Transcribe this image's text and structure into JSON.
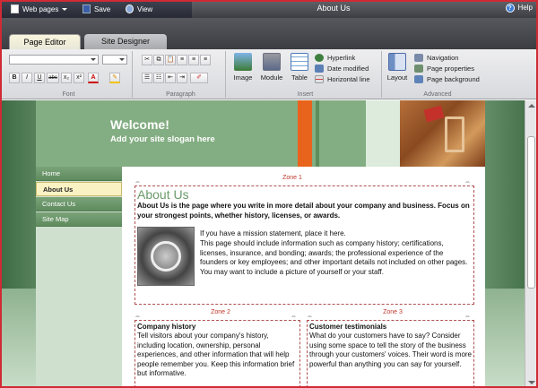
{
  "app": {
    "title": "About Us",
    "help_label": "Help"
  },
  "topbar": {
    "web_pages": "Web pages",
    "save": "Save",
    "view": "View"
  },
  "tabs": {
    "page_editor": "Page Editor",
    "site_designer": "Site Designer"
  },
  "ribbon": {
    "font_group": "Font",
    "paragraph_group": "Paragraph",
    "insert_group": "Insert",
    "advanced_group": "Advanced",
    "font_buttons": [
      "B",
      "I",
      "U",
      "abc",
      "x₂",
      "x²",
      "A",
      "✎"
    ],
    "insert_buttons": {
      "image": "Image",
      "module": "Module",
      "table": "Table"
    },
    "insert_links": {
      "hyperlink": "Hyperlink",
      "date_modified": "Date modified",
      "horizontal_line": "Horizontal line"
    },
    "advanced": {
      "layout": "Layout",
      "navigation": "Navigation",
      "page_properties": "Page properties",
      "page_background": "Page background"
    }
  },
  "site": {
    "welcome": "Welcome!",
    "slogan": "Add your site slogan here",
    "nav": [
      "Home",
      "About Us",
      "Contact Us",
      "Site Map"
    ],
    "active_nav": "About Us"
  },
  "zones": {
    "zone1": {
      "label": "Zone 1",
      "heading": "About Us",
      "intro": "About Us is the page where you write in more detail about your company and business. Focus on your strongest points, whether history, licenses, or awards.",
      "mission": "If you have a mission statement, place it here.",
      "body": "This page should include information such as company history; certifications, licenses, insurance, and bonding; awards; the professional experience of the founders or key employees; and other important details not included on other pages. You may want to include a picture of yourself or your staff."
    },
    "zone2": {
      "label": "Zone 2",
      "heading": "Company history",
      "body": "Tell visitors about your company's history, including location, ownership, personal experiences, and other information that will help people remember you. Keep this information brief but informative."
    },
    "zone3": {
      "label": "Zone 3",
      "heading": "Customer testimonials",
      "body": "What do your customers have to say? Consider using some space to tell the story of the business through your customers' voices. Their word is more powerful than anything you can say for yourself."
    }
  },
  "colors": {
    "header_green": "#83ad82",
    "orange": "#e8631b",
    "nav_active": "#fbf2c3",
    "zone_border": "#b05050"
  }
}
